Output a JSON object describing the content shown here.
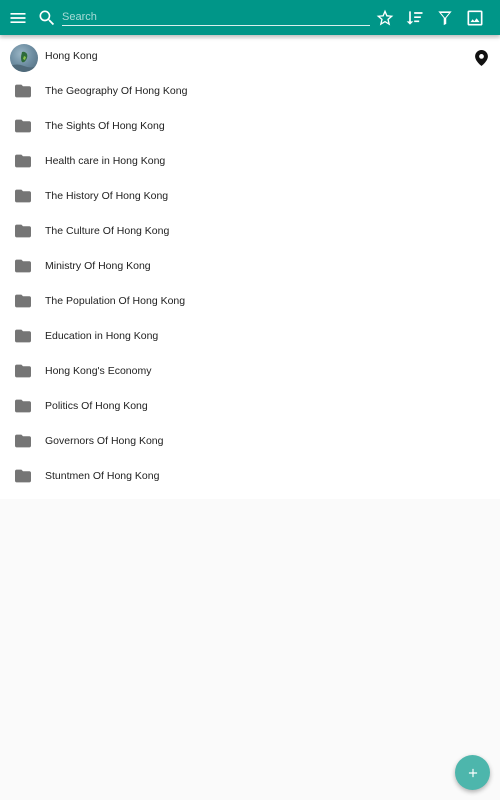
{
  "toolbar": {
    "menu_icon": "menu-icon",
    "search_icon": "search-icon",
    "search_placeholder": "Search",
    "search_value": "",
    "actions": [
      "star-outline-icon",
      "sort-icon",
      "filter-icon",
      "image-icon"
    ]
  },
  "header_item": {
    "label": "Hong Kong",
    "avatar": "location-photo",
    "trailing_icon": "map-pin-icon"
  },
  "folders": [
    {
      "label": "The Geography Of Hong Kong"
    },
    {
      "label": "The Sights Of Hong Kong"
    },
    {
      "label": "Health care in Hong Kong"
    },
    {
      "label": "The History Of Hong Kong"
    },
    {
      "label": "The Culture Of Hong Kong"
    },
    {
      "label": "Ministry Of Hong Kong"
    },
    {
      "label": "The Population Of Hong Kong"
    },
    {
      "label": "Education in Hong Kong"
    },
    {
      "label": "Hong Kong's Economy"
    },
    {
      "label": "Politics Of Hong Kong"
    },
    {
      "label": "Governors Of Hong Kong"
    },
    {
      "label": "Stuntmen Of Hong Kong"
    }
  ],
  "fab": {
    "icon": "plus-icon"
  },
  "colors": {
    "primary": "#009688",
    "fab": "#4db6ac",
    "folder_icon": "#757575",
    "text": "#212121",
    "background": "#fafafa"
  }
}
